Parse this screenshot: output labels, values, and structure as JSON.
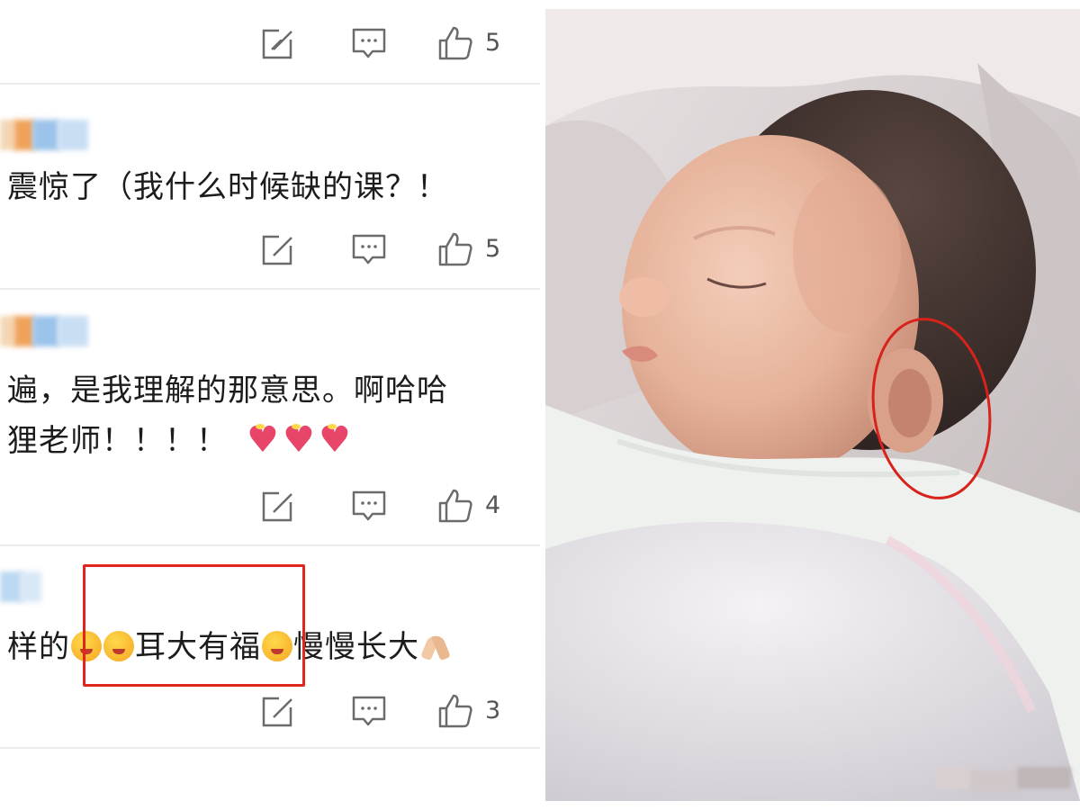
{
  "comments": [
    {
      "text_lines": [],
      "like_count": "5"
    },
    {
      "text_lines": [
        "震惊了（我什么时候缺的课？！"
      ],
      "like_count": "5"
    },
    {
      "text_lines": [
        "遍，是我理解的那意思。啊哈哈",
        "狸老师！！！！"
      ],
      "like_count": "4"
    },
    {
      "text_lines": [
        "样的",
        "耳大有福",
        "慢慢长大"
      ],
      "like_count": "3"
    }
  ],
  "icons": {
    "comment_action": "edit-square-icon",
    "reply_action": "chat-bubble-icon",
    "like_action": "thumbs-up-icon",
    "emojis_comment3": [
      "heart-emoji",
      "heart-emoji",
      "heart-emoji"
    ],
    "emojis_comment4": [
      "flushed-face-emoji",
      "flushed-face-emoji",
      "flushed-face-emoji",
      "praying-hands-emoji"
    ]
  },
  "colors": {
    "highlight_box": "#e0261f",
    "ear_circle": "#d8221c",
    "icon_gray": "#6b6b6b",
    "divider": "#ececec"
  }
}
